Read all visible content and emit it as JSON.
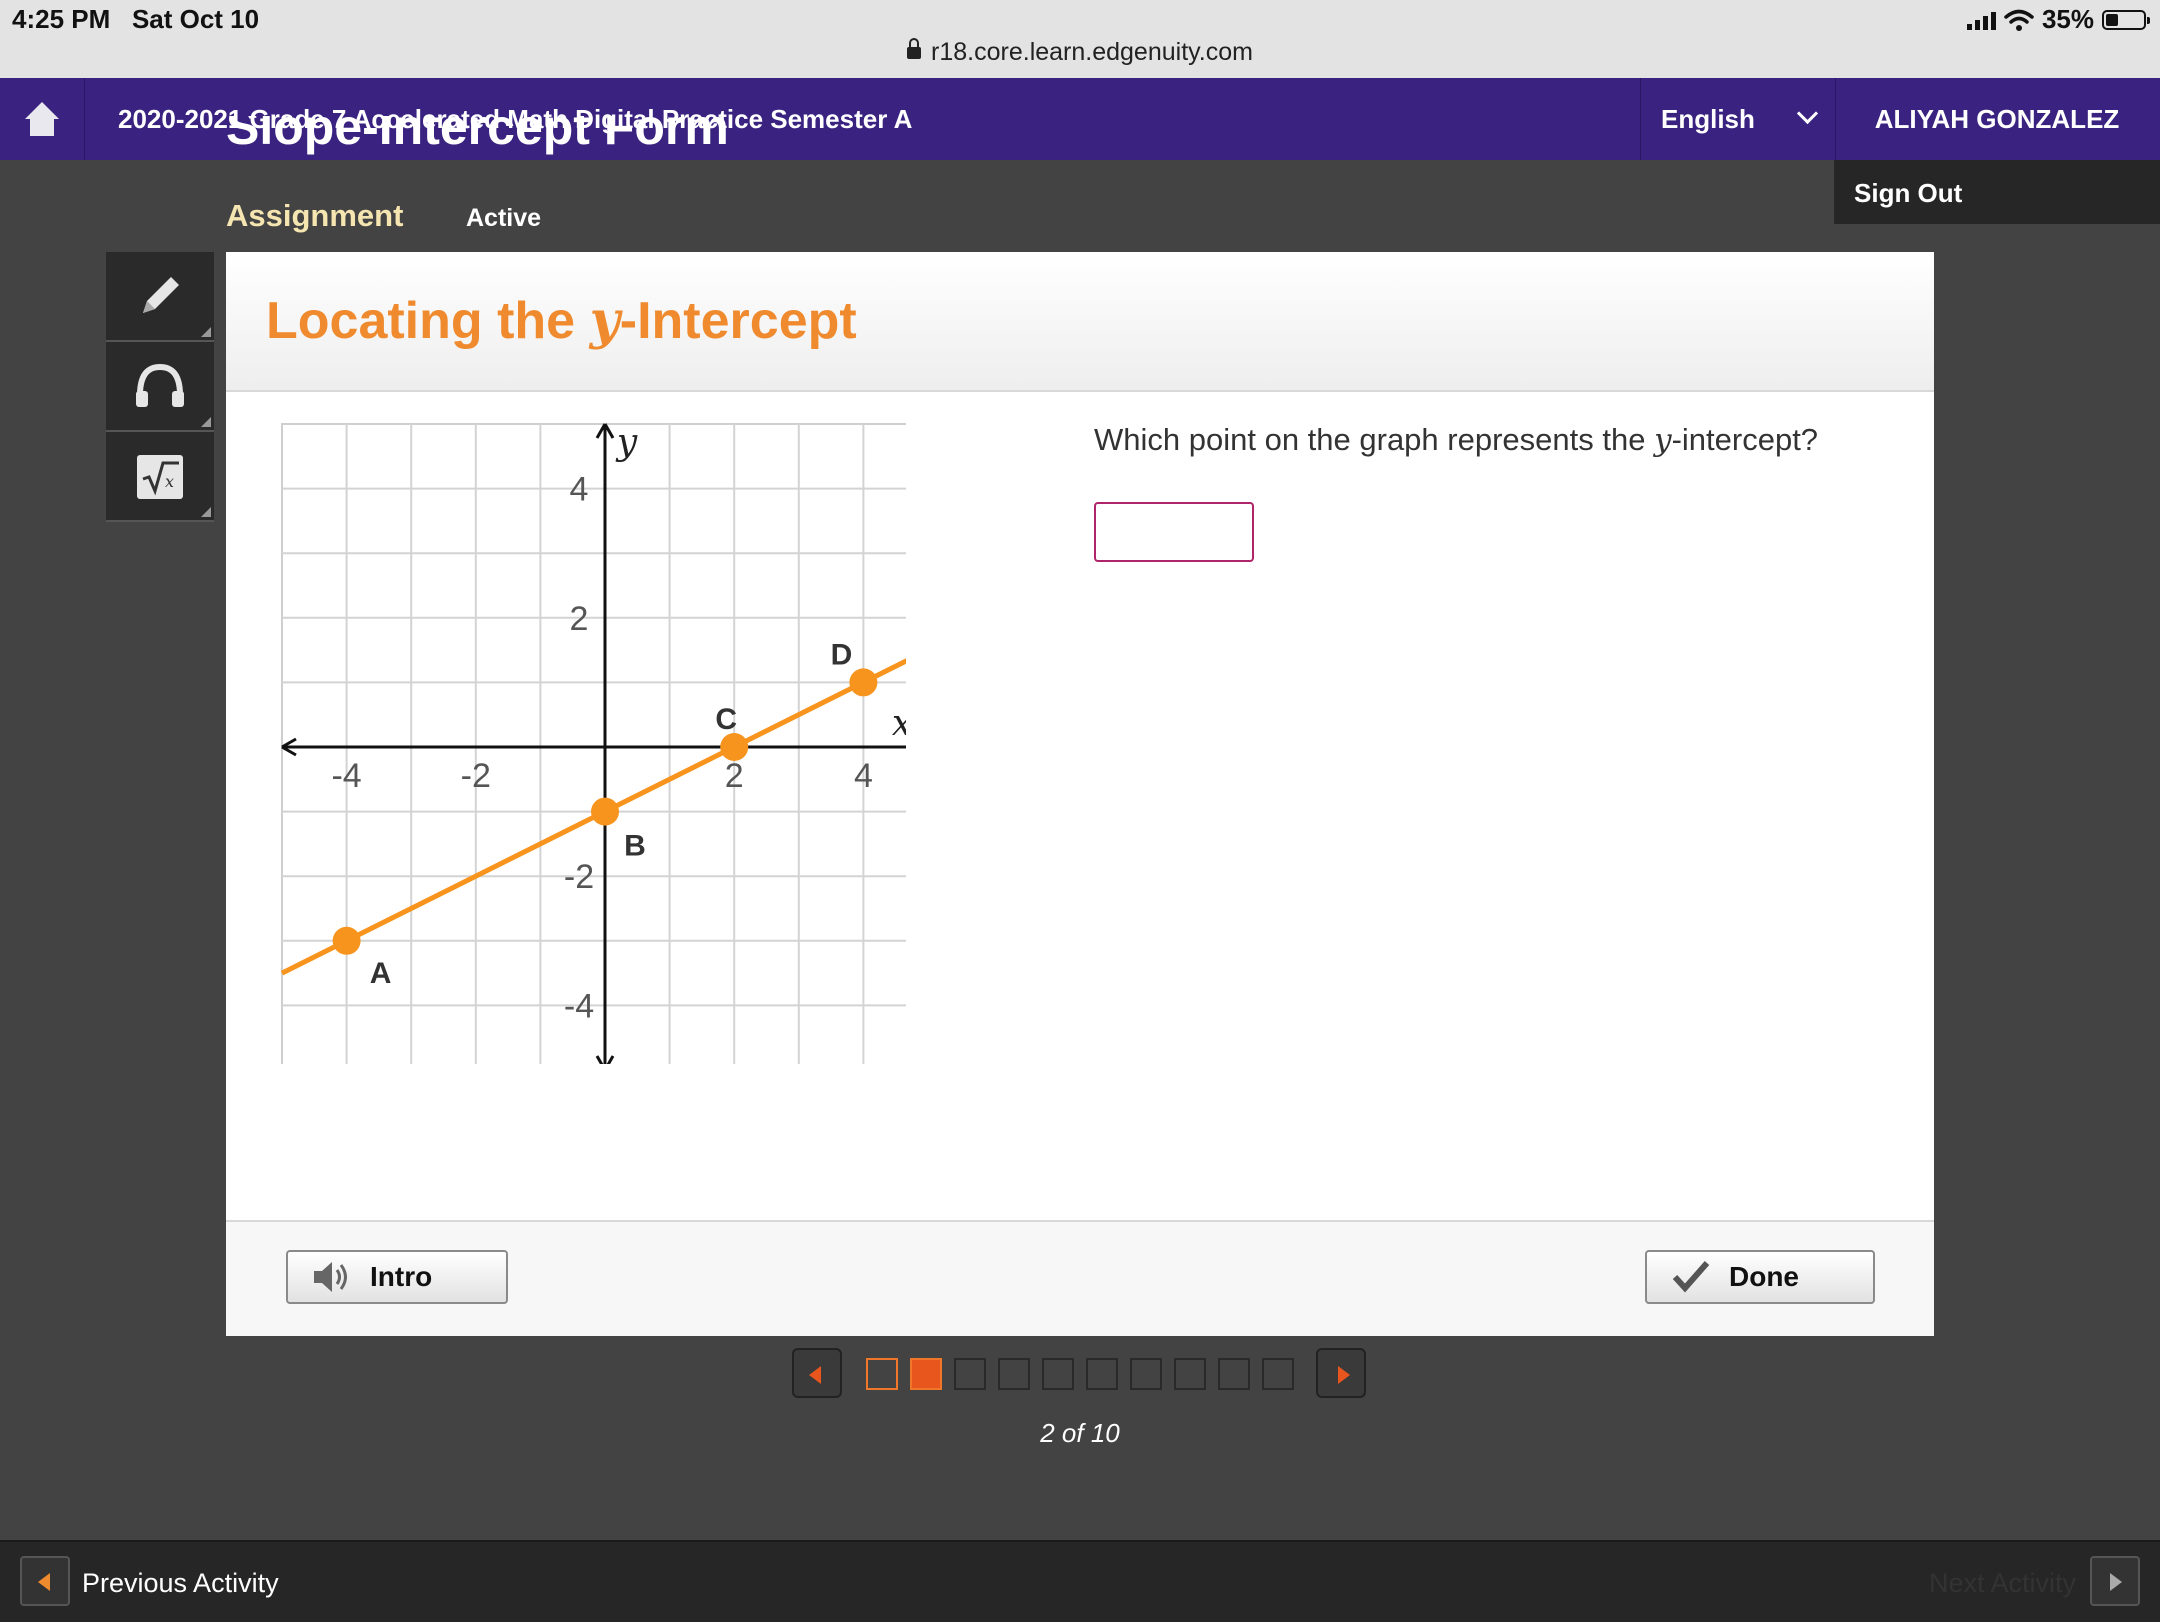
{
  "status_bar": {
    "time": "4:25 PM",
    "date": "Sat Oct 10",
    "url": "r18.core.learn.edgenuity.com",
    "battery": "35%"
  },
  "nav": {
    "course_title": "2020-2021 Grade 7 Accelerated Math Digital Practice Semester A",
    "language": "English",
    "user_name": "ALIYAH GONZALEZ",
    "sign_out": "Sign Out",
    "icons": {
      "home": "home-icon",
      "language_toggle": "chevron-down-icon"
    },
    "colors": {
      "nav_bg": "#3a2380"
    }
  },
  "lesson": {
    "title": "Slope-Intercept Form",
    "tab_label": "Assignment",
    "status": "Active"
  },
  "tools": [
    {
      "name": "pencil-icon"
    },
    {
      "name": "headphones-icon"
    },
    {
      "name": "square-root-icon"
    }
  ],
  "card": {
    "title_prefix": "Locating the ",
    "title_var": "y",
    "title_suffix": "-Intercept",
    "question_prefix": "Which point on the graph represents the ",
    "question_var": "y",
    "question_suffix": "-intercept?",
    "answer_value": "",
    "intro_label": "Intro",
    "done_label": "Done",
    "colors": {
      "title": "#f08a2e",
      "line": "#f7941d",
      "answer_border": "#b0246a"
    }
  },
  "graph": {
    "x_axis_label": "x",
    "y_axis_label": "y",
    "x_range": [
      -5,
      5
    ],
    "y_range": [
      -5,
      5
    ],
    "x_ticks": [
      {
        "value": -4,
        "label": "-4"
      },
      {
        "value": -2,
        "label": "-2"
      },
      {
        "value": 2,
        "label": "2"
      },
      {
        "value": 4,
        "label": "4"
      }
    ],
    "y_ticks": [
      {
        "value": 4,
        "label": "4"
      },
      {
        "value": 2,
        "label": "2"
      },
      {
        "value": -2,
        "label": "-2"
      },
      {
        "value": -4,
        "label": "-4"
      }
    ],
    "points": [
      {
        "label": "A",
        "x": -4,
        "y": -3
      },
      {
        "label": "B",
        "x": 0,
        "y": -1
      },
      {
        "label": "C",
        "x": 2,
        "y": 0
      },
      {
        "label": "D",
        "x": 4,
        "y": 1
      }
    ],
    "line": {
      "slope": 0.5,
      "intercept": -1
    }
  },
  "pager": {
    "total": 10,
    "current": 2,
    "count_text": "2 of 10"
  },
  "footer": {
    "prev_label": "Previous Activity",
    "next_label": "Next Activity"
  }
}
